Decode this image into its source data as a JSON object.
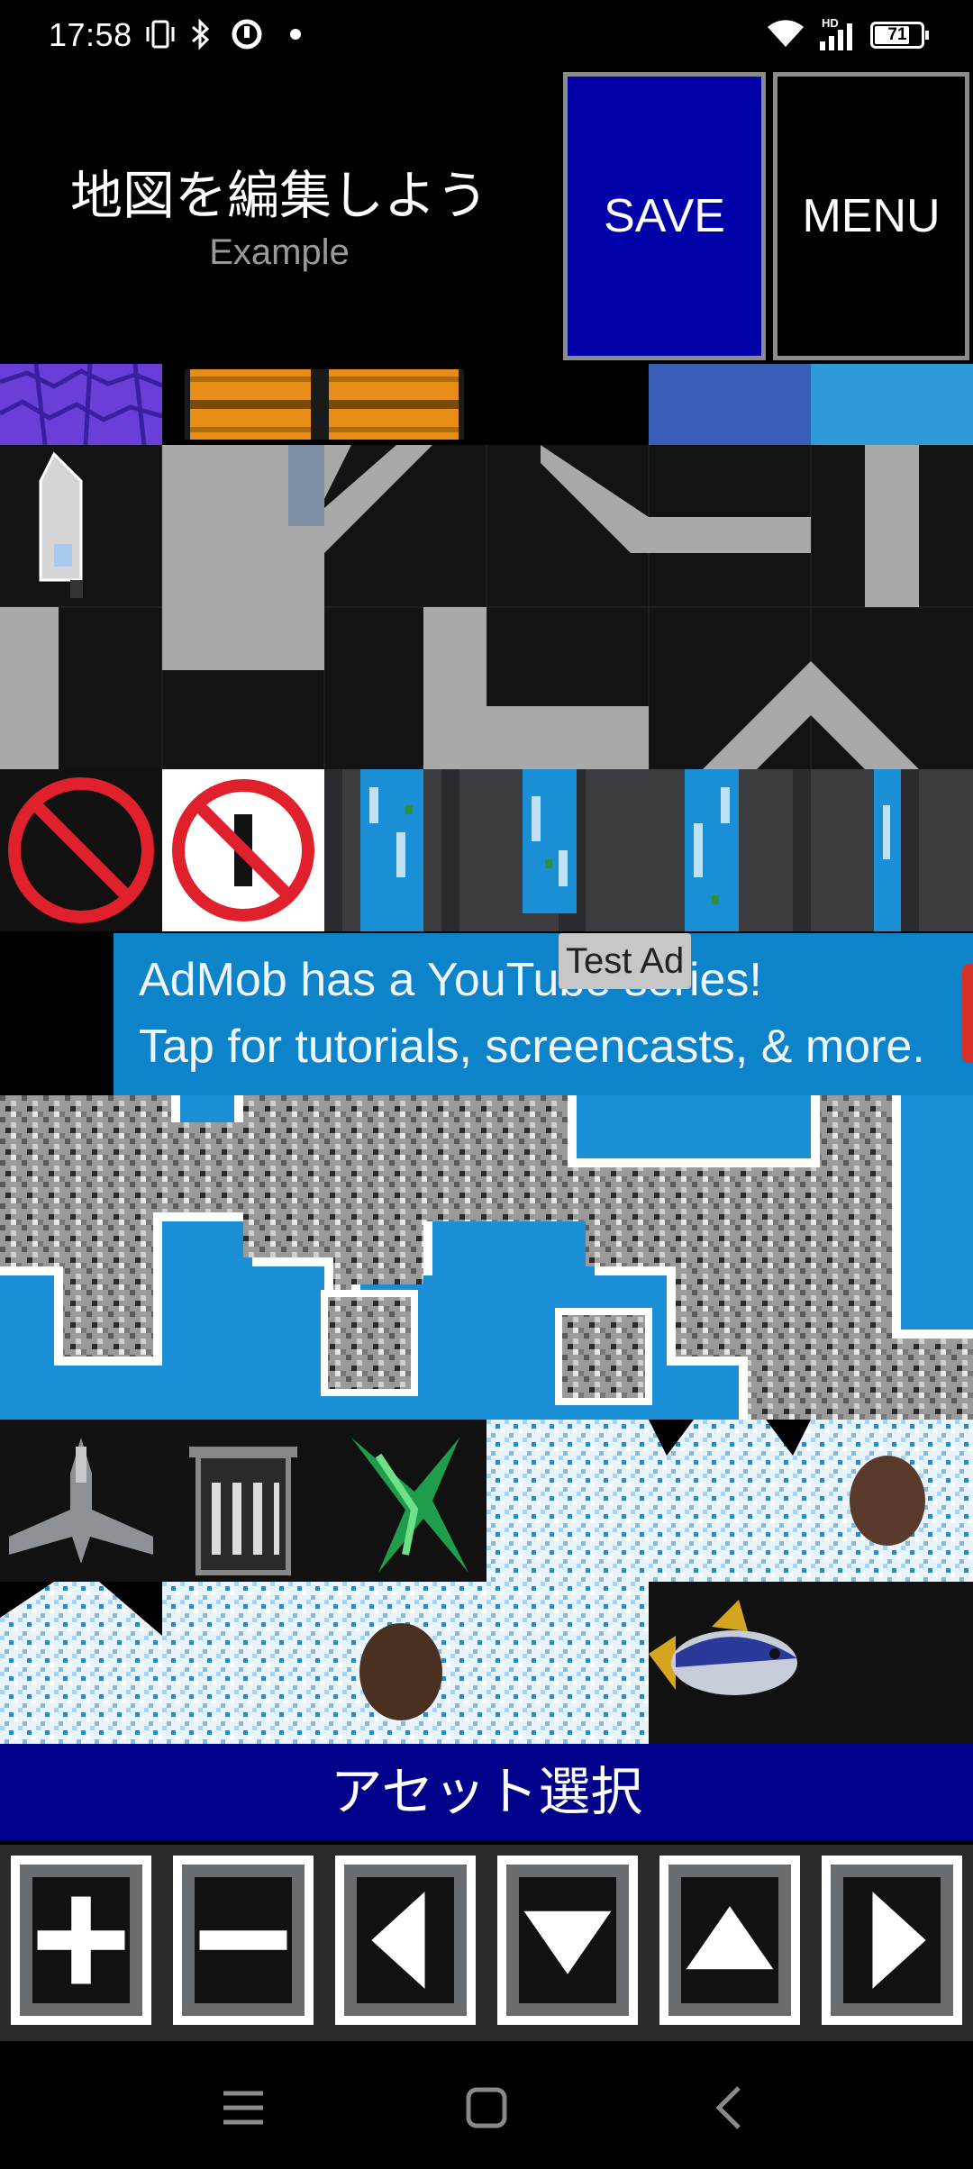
{
  "status_bar": {
    "time": "17:58",
    "battery": "71",
    "icons": [
      "vibrate-icon",
      "bluetooth-icon",
      "data-saver-icon",
      "dot-icon",
      "wifi-icon",
      "hd-icon",
      "signal-icon",
      "battery-icon"
    ]
  },
  "header": {
    "title": "地図を編集しよう",
    "subtitle": "Example"
  },
  "buttons": {
    "save": "SAVE",
    "menu": "MENU"
  },
  "ad": {
    "label": "Test Ad",
    "line1": "AdMob has a YouTube series!",
    "line2": "Tap for tutorials, screencasts, & more."
  },
  "asset_bar": {
    "label": "アセット選択"
  },
  "toolbar": {
    "icons": [
      "plus-icon",
      "minus-icon",
      "arrow-left-icon",
      "arrow-down-icon",
      "arrow-up-icon",
      "arrow-right-icon"
    ]
  },
  "colors": {
    "save_bg": "#0000a8",
    "asset_bar_bg": "#00008a",
    "ad_bg": "#0d83c9",
    "water": "#1a8fd6"
  }
}
